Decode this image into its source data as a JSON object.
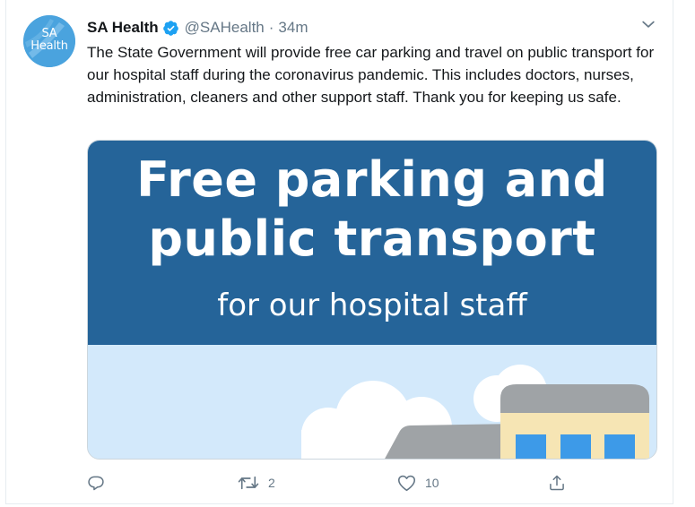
{
  "tweet": {
    "display_name": "SA Health",
    "handle": "@SAHealth",
    "separator": "·",
    "timestamp": "34m",
    "text": "The State Government will provide free car parking and travel on public transport for our hospital staff during the coronavirus pandemic. This includes doctors, nurses, administration, cleaners and other support staff. Thank you for keeping us safe.",
    "verified": true
  },
  "avatar": {
    "line1": "SA",
    "line2": "Health"
  },
  "media": {
    "headline_line1": "Free parking and",
    "headline_line2": "public transport",
    "subline": "for our hospital staff",
    "banner_color": "#256499",
    "sky_color": "#d3e9fb"
  },
  "actions": {
    "reply_count": "",
    "retweet_count": "2",
    "like_count": "10"
  },
  "colors": {
    "verified": "#1da1f2",
    "secondary_text": "#657786",
    "accent": "#1da1f2"
  },
  "icons": [
    "chevron-down-icon",
    "verified-icon",
    "reply-icon",
    "retweet-icon",
    "like-icon",
    "share-icon"
  ]
}
